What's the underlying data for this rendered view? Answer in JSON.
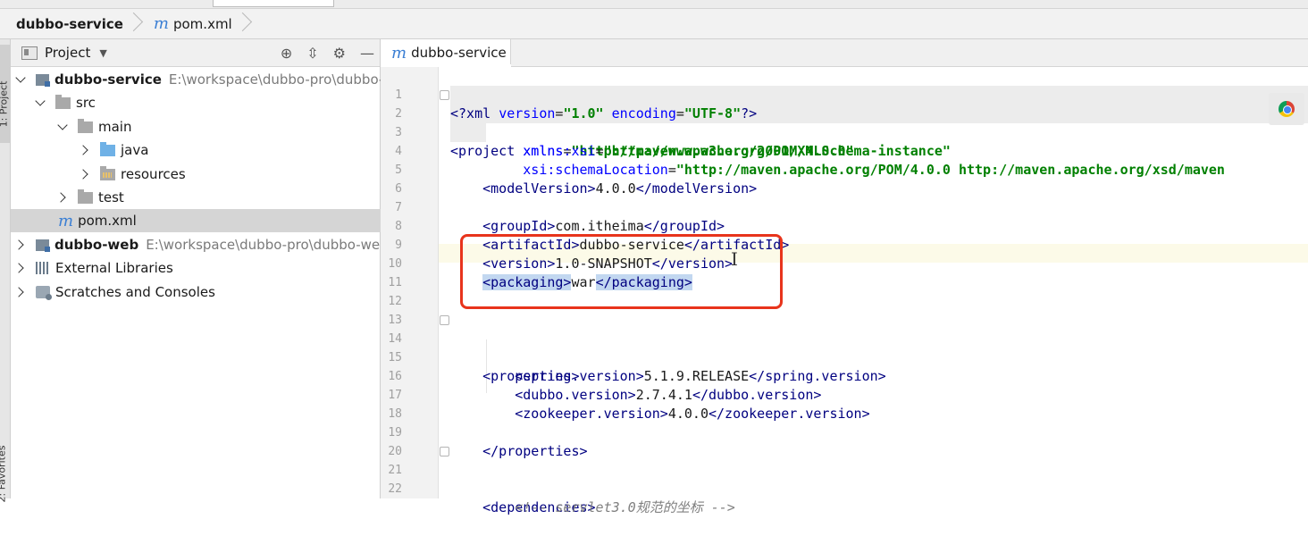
{
  "breadcrumb": {
    "project": "dubbo-service",
    "file": "pom.xml",
    "file_icon": "m"
  },
  "tool_strip": {
    "project_tab": "1: Project",
    "favorites_tab": "2: Favorites"
  },
  "project_panel": {
    "title": "Project",
    "tree": {
      "root1_name": "dubbo-service",
      "root1_path": "E:\\workspace\\dubbo-pro\\dubbo-",
      "src": "src",
      "main": "main",
      "java": "java",
      "resources": "resources",
      "test": "test",
      "pom": "pom.xml",
      "root2_name": "dubbo-web",
      "root2_path": "E:\\workspace\\dubbo-pro\\dubbo-we",
      "external_libraries": "External Libraries",
      "scratches": "Scratches and Consoles"
    }
  },
  "editor": {
    "tab_label": "dubbo-service",
    "tab_icon": "m",
    "line_numbers": [
      "1",
      "2",
      "3",
      "4",
      "5",
      "6",
      "7",
      "8",
      "9",
      "10",
      "11",
      "12",
      "13",
      "14",
      "15",
      "16",
      "17",
      "18",
      "19",
      "20",
      "21",
      "22"
    ],
    "code": {
      "l1_decl": "<?xml ",
      "l1_attr1": "version",
      "l1_val1": "\"1.0\"",
      "l1_attr2": "encoding",
      "l1_val2": "\"UTF-8\"",
      "l1_end": "?>",
      "l2_tag": "<project ",
      "l2_attr": "xmlns",
      "l2_val": "\"http://maven.apache.org/POM/4.0.0\"",
      "l3_attr": "xmlns:xsi",
      "l3_val": "\"http://www.w3.org/2001/XMLSchema-instance\"",
      "l4_attr": "xsi:schemaLocation",
      "l4_val": "\"http://maven.apache.org/POM/4.0.0 http://maven.apache.org/xsd/maven",
      "l5_open": "<modelVersion>",
      "l5_text": "4.0.0",
      "l5_close": "</modelVersion>",
      "l7_open": "<groupId>",
      "l7_text": "com.itheima",
      "l7_close": "</groupId>",
      "l8_open": "<artifactId>",
      "l8_text": "dubbo-service",
      "l8_close": "</artifactId>",
      "l9_open": "<version>",
      "l9_text": "1.0-SNAPSHOT",
      "l9_close": "</version>",
      "l10_open": "<packaging>",
      "l10_text": "war",
      "l10_close": "</packaging>",
      "l14_open": "<properties>",
      "l15_open": "<spring.version>",
      "l15_text": "5.1.9.RELEASE",
      "l15_close": "</spring.version>",
      "l16_open": "<dubbo.version>",
      "l16_text": "2.7.4.1",
      "l16_close": "</dubbo.version>",
      "l17_open": "<zookeeper.version>",
      "l17_text": "4.0.0",
      "l17_close": "</zookeeper.version>",
      "l19_close": "</properties>",
      "l21_open": "<dependencies>",
      "l22_comment": "<!-- servlet3.0规范的坐标 -->"
    }
  },
  "colors": {
    "tag": "#000080",
    "attribute": "#0000ff",
    "string": "#008000",
    "comment": "#808080",
    "annotation_box": "#e8341c",
    "selection": "#c2d7f0"
  }
}
